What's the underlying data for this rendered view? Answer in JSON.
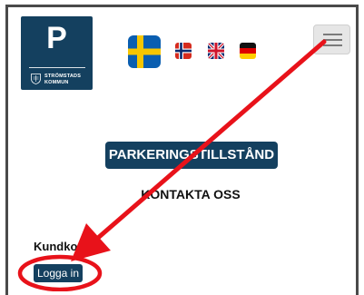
{
  "header": {
    "logo": {
      "letter": "P",
      "municipality_line1": "STRÖMSTADS",
      "municipality_line2": "KOMMUN"
    },
    "languages": [
      {
        "name": "Svenska",
        "icon": "flag-sweden-icon"
      },
      {
        "name": "Norsk",
        "icon": "flag-norway-icon"
      },
      {
        "name": "English",
        "icon": "flag-uk-icon"
      },
      {
        "name": "Deutsch",
        "icon": "flag-germany-icon"
      }
    ],
    "menu_icon": "hamburger-menu-icon"
  },
  "main": {
    "title": "PARKERINGSTILLSTÅND",
    "contact_link": "KONTAKTA OSS",
    "account_label": "Kundkonto:",
    "login_button": "Logga in"
  },
  "annotation": {
    "color": "#e8121a"
  },
  "colors": {
    "brand": "#14405f",
    "frame": "#4a4a4a"
  }
}
